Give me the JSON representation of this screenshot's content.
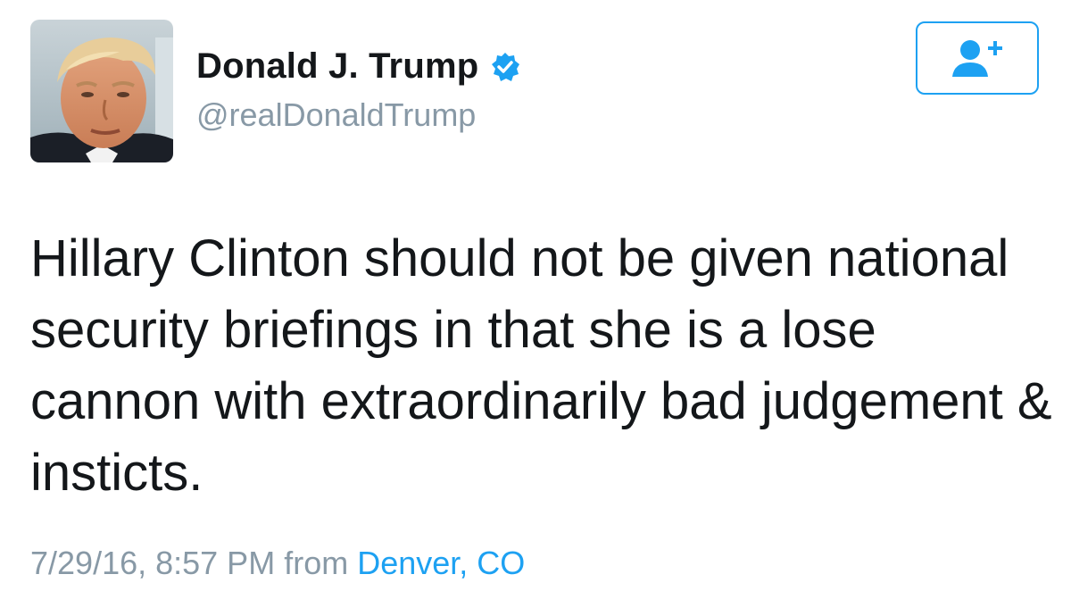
{
  "author": {
    "display_name": "Donald J. Trump",
    "handle": "@realDonaldTrump",
    "verified": true,
    "avatar_icon": "profile-photo"
  },
  "follow_button": {
    "icon": "add-user-icon",
    "color": "#1da1f2"
  },
  "tweet": {
    "text": "Hillary Clinton should not be given national security briefings in that she is a lose cannon with extraordinarily bad judgement & insticts."
  },
  "meta": {
    "timestamp": "7/29/16, 8:57 PM",
    "from_label": "from",
    "location": "Denver, CO"
  },
  "colors": {
    "text": "#14171a",
    "secondary": "#8899a6",
    "accent": "#1da1f2"
  }
}
